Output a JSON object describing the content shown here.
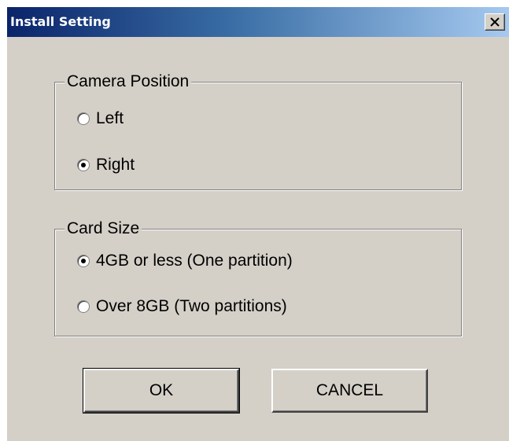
{
  "window": {
    "title": "Install Setting",
    "close_label": "Close"
  },
  "camera_position": {
    "legend": "Camera Position",
    "options": [
      {
        "label": "Left",
        "checked": false
      },
      {
        "label": "Right",
        "checked": true
      }
    ]
  },
  "card_size": {
    "legend": "Card Size",
    "options": [
      {
        "label": "4GB or less (One partition)",
        "checked": true
      },
      {
        "label": "Over 8GB (Two partitions)",
        "checked": false
      }
    ]
  },
  "buttons": {
    "ok_label": "OK",
    "cancel_label": "CANCEL"
  },
  "colors": {
    "title_gradient_start": "#0a246a",
    "title_gradient_end": "#a6caf0",
    "dialog_face": "#d4d0c8"
  }
}
